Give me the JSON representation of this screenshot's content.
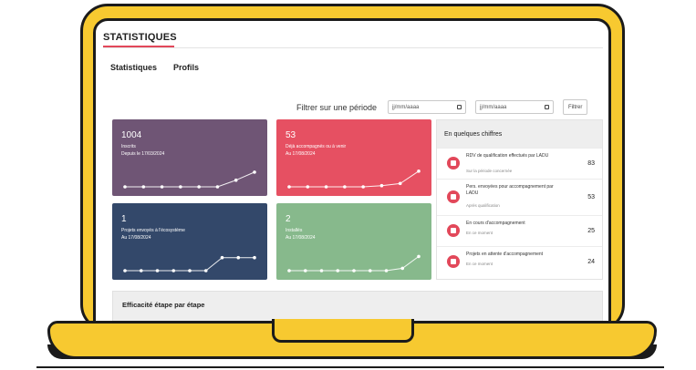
{
  "app": {
    "title": "STATISTIQUES"
  },
  "tabs": [
    {
      "label": "Statistiques"
    },
    {
      "label": "Profils"
    }
  ],
  "filter": {
    "label": "Filtrer sur une période",
    "date_from_placeholder": "jj/mm/aaaa",
    "date_to_placeholder": "jj/mm/aaaa",
    "button_label": "Filtrer"
  },
  "cards": [
    {
      "value": "1004",
      "label": "Inscrits",
      "date": "Depuis le 17/03/2024",
      "color": "#6f5575",
      "trend": [
        0,
        0,
        0,
        0,
        0,
        0,
        0.28,
        0.62
      ]
    },
    {
      "value": "53",
      "label": "Déjà accompagnés ou à venir",
      "date": "Au 17/08/2024",
      "color": "#e65062",
      "trend": [
        0,
        0,
        0,
        0,
        0,
        0.05,
        0.14,
        0.66
      ]
    },
    {
      "value": "1",
      "label": "Projets envoyés à l'écosystème",
      "date": "Au 17/08/2024",
      "color": "#33486a",
      "trend": [
        0,
        0,
        0,
        0,
        0,
        0,
        0.55,
        0.55,
        0.55
      ]
    },
    {
      "value": "2",
      "label": "Installés",
      "date": "Au 17/08/2024",
      "color": "#87b98c",
      "trend": [
        0,
        0,
        0,
        0,
        0,
        0,
        0,
        0.1,
        0.6
      ]
    }
  ],
  "side_panel": {
    "title": "En quelques chiffres",
    "items": [
      {
        "text": "RDV de qualification effectués par LADU",
        "sub": "Sur la période concernée",
        "value": "83",
        "icon": "calendar-icon"
      },
      {
        "text": "Pers. envoyées pour accompagnement par LADU",
        "sub": "Après qualification",
        "value": "53",
        "icon": "folder-icon"
      },
      {
        "text": "En cours d'accompagnement",
        "sub": "En ce moment",
        "value": "25",
        "icon": "folder-icon"
      },
      {
        "text": "Projets en attente d'accompagnement",
        "sub": "En ce moment",
        "value": "24",
        "icon": "clock-icon"
      }
    ]
  },
  "efficiency": {
    "title": "Efficacité étape par étape"
  },
  "colors": {
    "frame": "#f7c930",
    "accent": "#e2485a"
  }
}
